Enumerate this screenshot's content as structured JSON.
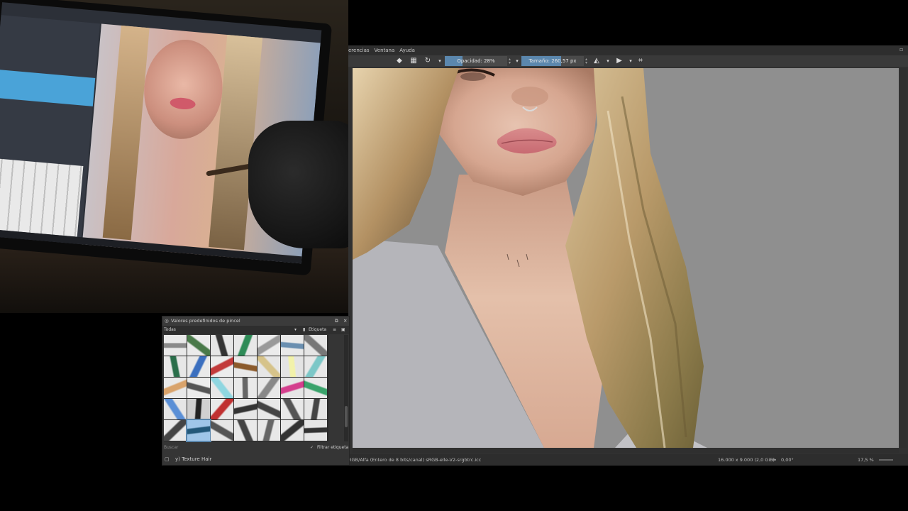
{
  "menu": {
    "items": [
      "erencias",
      "Ventana",
      "Ayuda"
    ]
  },
  "toolbar": {
    "opacity_label": "Opacidad: 28%",
    "opacity_value": 0.28,
    "size_label": "Tamaño: 260,57 px",
    "icons": [
      "eraser-icon",
      "alpha-lock-icon",
      "reset-icon",
      "mirror-horizontal-icon",
      "mirror-vertical-icon",
      "wrap-around-icon"
    ]
  },
  "status": {
    "color_space": "RGB/Alfa (Entero de 8 bits/canal)  sRGB-elle-V2-srgbtrc.icc",
    "dimensions": "16.000 x 9.000 (2,0 GiB)",
    "rotation": "0,00°",
    "zoom": "17,5 %"
  },
  "presets": {
    "title": "Valores predefinidos de pincel",
    "tag_filter": "Todas",
    "tag_label": "Etiqueta",
    "search_placeholder": "Buscar",
    "filter_tag_label": "Filtrar etiqueta",
    "current_preset": "y) Texture Hair",
    "selected_index": 29
  },
  "colors": {
    "accent": "#5b87ad",
    "canvas_bg": "#8f8f8f",
    "window_bg": "#313131"
  }
}
